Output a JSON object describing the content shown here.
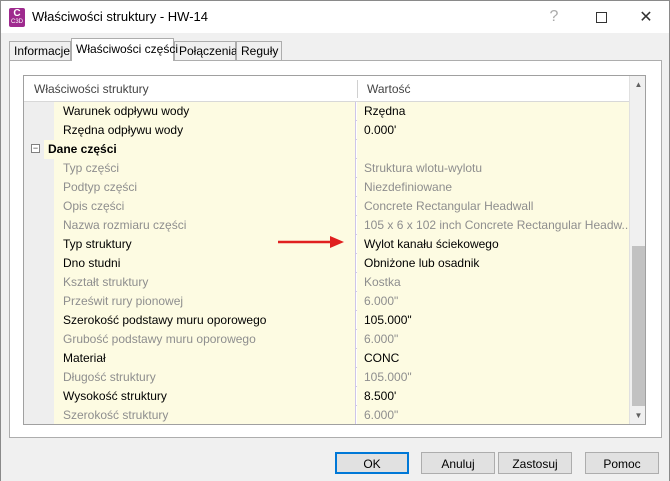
{
  "window": {
    "title": "Właściwości struktury - HW-14",
    "icon_letter": "C",
    "icon_sub": "C3D",
    "help_glyph": "?",
    "close_glyph": "✕"
  },
  "tabs": [
    {
      "label": "Informacje",
      "active": false
    },
    {
      "label": "Właściwości części",
      "active": true
    },
    {
      "label": "Połączenia",
      "active": false
    },
    {
      "label": "Reguły",
      "active": false
    }
  ],
  "grid": {
    "col_name": "Właściwości struktury",
    "col_value": "Wartość",
    "group_label": "Dane części",
    "collapse_glyph": "−",
    "rows": [
      {
        "name": "Warunek odpływu wody",
        "value": "Rzędna",
        "disabled": false
      },
      {
        "name": "Rzędna odpływu wody",
        "value": "0.000'",
        "disabled": false
      },
      {
        "name": "Typ części",
        "value": "Struktura wlotu-wylotu",
        "disabled": true
      },
      {
        "name": "Podtyp części",
        "value": "Niezdefiniowane",
        "disabled": true
      },
      {
        "name": "Opis części",
        "value": "Concrete Rectangular Headwall",
        "disabled": true
      },
      {
        "name": "Nazwa rozmiaru części",
        "value": "105 x 6 x 102 inch Concrete Rectangular Headw...",
        "disabled": true
      },
      {
        "name": "Typ struktury",
        "value": "Wylot kanału ściekowego",
        "disabled": false
      },
      {
        "name": "Dno studni",
        "value": "Obniżone lub osadnik",
        "disabled": false
      },
      {
        "name": "Kształt struktury",
        "value": "Kostka",
        "disabled": true
      },
      {
        "name": "Prześwit rury pionowej",
        "value": "6.000\"",
        "disabled": true
      },
      {
        "name": "Szerokość podstawy muru oporowego",
        "value": "105.000\"",
        "disabled": false
      },
      {
        "name": "Grubość podstawy muru oporowego",
        "value": "6.000\"",
        "disabled": true
      },
      {
        "name": "Materiał",
        "value": "CONC",
        "disabled": false
      },
      {
        "name": "Długość struktury",
        "value": "105.000\"",
        "disabled": true
      },
      {
        "name": "Wysokość struktury",
        "value": "8.500'",
        "disabled": false
      },
      {
        "name": "Szerokość struktury",
        "value": "6.000\"",
        "disabled": true
      }
    ]
  },
  "buttons": {
    "ok": "OK",
    "cancel": "Anuluj",
    "apply": "Zastosuj",
    "help": "Pomoc"
  },
  "colors": {
    "row_bg": "#fdfbe2",
    "row_border": "#cec6e8",
    "arrow": "#e02020",
    "focus_border": "#0078d7"
  }
}
